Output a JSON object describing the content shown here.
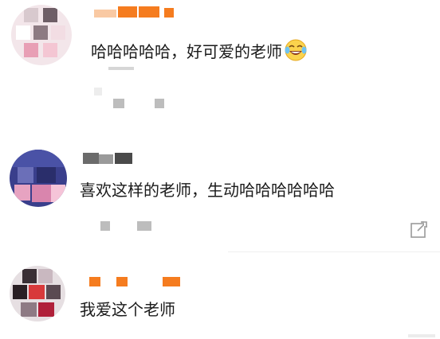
{
  "comments": [
    {
      "text": "哈哈哈哈哈，好可爱的老师",
      "emoji": "laughing-tears-emoji"
    },
    {
      "text": "喜欢这样的老师，生动哈哈哈哈哈哈"
    },
    {
      "text": "我爱这个老师"
    }
  ],
  "colors": {
    "username_orange": "#f57c1f",
    "username_gray": "#6b6b6b",
    "text": "#1a1a1a",
    "meta": "#bdbdbd"
  },
  "icons": {
    "share": "share-arrow-icon"
  }
}
